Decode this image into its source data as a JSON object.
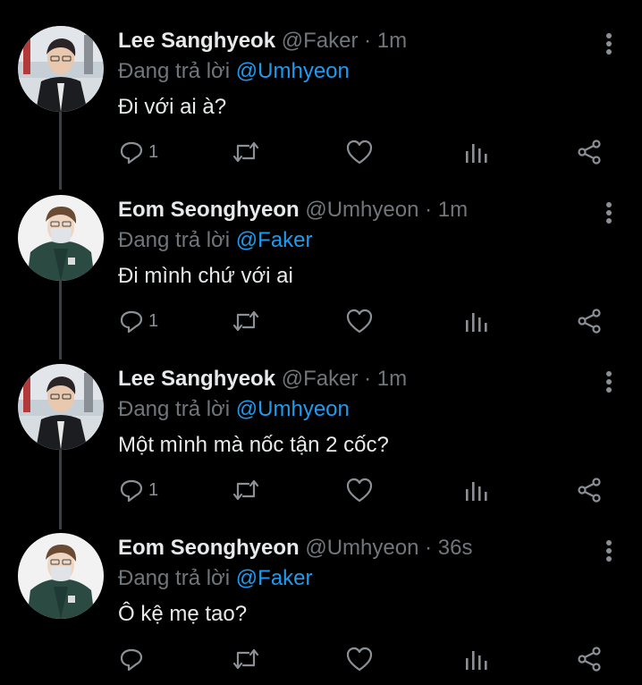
{
  "tweets": [
    {
      "author_name": "Lee Sanghyeok",
      "author_handle": "@Faker",
      "separator": "·",
      "time": "1m",
      "replying_prefix": "Đang trả lời",
      "replying_to": "@Umhyeon",
      "text": "Đi với ai à?",
      "reply_count": "1",
      "avatar": "faker-avatar"
    },
    {
      "author_name": "Eom Seonghyeon",
      "author_handle": "@Umhyeon",
      "separator": "·",
      "time": "1m",
      "replying_prefix": "Đang trả lời",
      "replying_to": "@Faker",
      "text": "Đi mình chứ với ai",
      "reply_count": "1",
      "avatar": "umhyeon-avatar"
    },
    {
      "author_name": "Lee Sanghyeok",
      "author_handle": "@Faker",
      "separator": "·",
      "time": "1m",
      "replying_prefix": "Đang trả lời",
      "replying_to": "@Umhyeon",
      "text": "Một mình mà nốc tận 2 cốc?",
      "reply_count": "1",
      "avatar": "faker-avatar"
    },
    {
      "author_name": "Eom Seonghyeon",
      "author_handle": "@Umhyeon",
      "separator": "·",
      "time": "36s",
      "replying_prefix": "Đang trả lời",
      "replying_to": "@Faker",
      "text": "Ô kệ mẹ tao?",
      "reply_count": "",
      "avatar": "umhyeon-avatar"
    }
  ],
  "icons": {
    "reply": "reply-icon",
    "retweet": "retweet-icon",
    "like": "like-icon",
    "views": "views-icon",
    "share": "share-icon",
    "more": "more-icon"
  },
  "colors": {
    "background": "#000000",
    "text": "#e7e9ea",
    "secondary": "#71767b",
    "mention": "#1d9bf0",
    "thread_line": "#3b3f42"
  }
}
